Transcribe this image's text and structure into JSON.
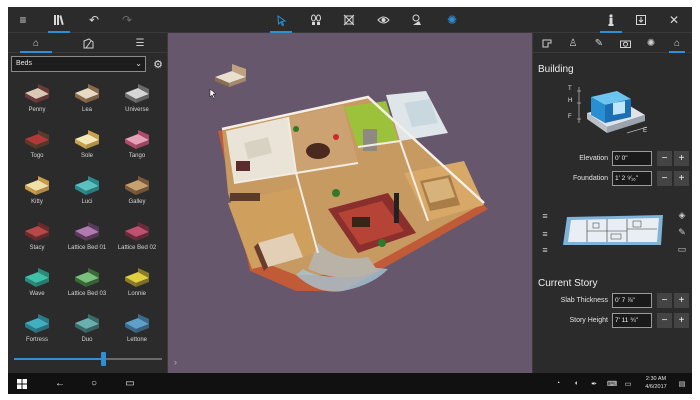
{
  "app": {
    "accent_color": "#2d8fd6",
    "viewport_color": "#67576d"
  },
  "toolbar": {
    "left_icons": [
      "menu-icon",
      "library-icon",
      "undo-icon",
      "redo-icon"
    ],
    "center_icons": [
      "cursor-icon",
      "footprints-icon",
      "layers-icon",
      "eye-icon",
      "shadows-icon",
      "sun-icon"
    ],
    "right_icons": [
      "figure-icon",
      "export-icon",
      "close-icon"
    ]
  },
  "left_panel": {
    "tabs": [
      "building-tab-icon",
      "materials-tab-icon",
      "list-tab-icon"
    ],
    "category": "Beds",
    "slider_value": 0.6,
    "items": [
      {
        "label": "Penny"
      },
      {
        "label": "Lea"
      },
      {
        "label": "Universe"
      },
      {
        "label": "Togo"
      },
      {
        "label": "Sole"
      },
      {
        "label": "Tango"
      },
      {
        "label": "Kitty"
      },
      {
        "label": "Luci"
      },
      {
        "label": "Galley"
      },
      {
        "label": "Stacy"
      },
      {
        "label": "Lattice Bed 01"
      },
      {
        "label": "Lattice Bed 02"
      },
      {
        "label": "Wave"
      },
      {
        "label": "Lattice Bed 03"
      },
      {
        "label": "Lonnie"
      },
      {
        "label": "Fortress"
      },
      {
        "label": "Duo"
      },
      {
        "label": "Lettone"
      }
    ]
  },
  "right_panel": {
    "tabs": [
      "object-tab-icon",
      "stamp-tab-icon",
      "paint-tab-icon",
      "camera-tab-icon",
      "light-tab-icon",
      "building-tab-icon"
    ],
    "building_title": "Building",
    "diagram_labels": {
      "t": "T",
      "h": "H",
      "f": "F",
      "e": "E"
    },
    "elevation_label": "Elevation",
    "elevation_value": "0' 0\"",
    "foundation_label": "Foundation",
    "foundation_value": "1' 2 ⁹⁄₁₆\"",
    "current_story_title": "Current Story",
    "slab_thickness_label": "Slab Thickness",
    "slab_thickness_value": "0' 7 ⅞\"",
    "story_height_label": "Story Height",
    "story_height_value": "7' 11 ¾\"",
    "minus": "−",
    "plus": "+"
  },
  "taskbar": {
    "time": "2:30 AM",
    "date": "4/6/2017"
  }
}
